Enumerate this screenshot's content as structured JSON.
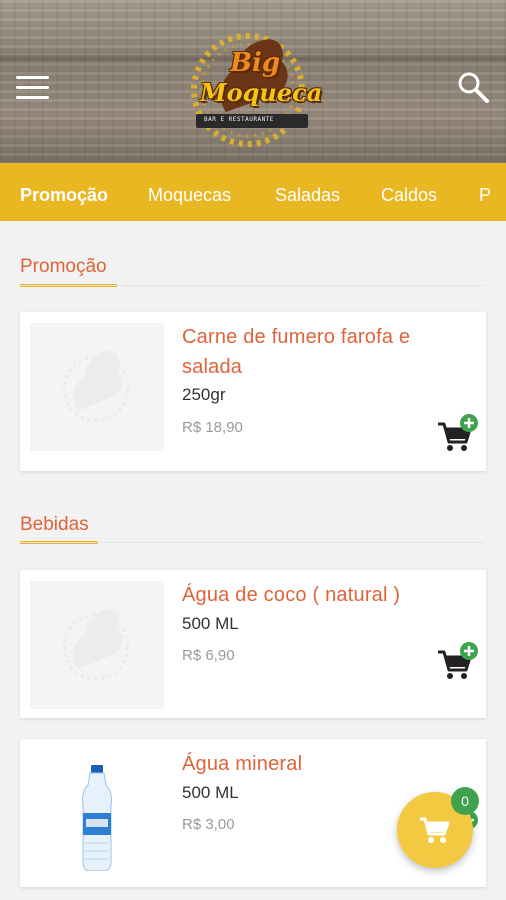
{
  "header": {
    "logo_line1": "Big",
    "logo_line2": "Moqueca",
    "logo_subtitle": "BAR E RESTAURANTE"
  },
  "tabs": [
    {
      "label": "Promoção",
      "active": true
    },
    {
      "label": "Moquecas",
      "active": false
    },
    {
      "label": "Saladas",
      "active": false
    },
    {
      "label": "Caldos",
      "active": false
    },
    {
      "label": "P",
      "active": false
    }
  ],
  "sections": [
    {
      "title": "Promoção",
      "products": [
        {
          "name": "Carne de fumero farofa e salada",
          "description": "250gr",
          "price": "R$ 18,90",
          "image": "logo-placeholder"
        }
      ]
    },
    {
      "title": "Bebidas",
      "products": [
        {
          "name": "Água de coco ( natural )",
          "description": "500 ML",
          "price": "R$ 6,90",
          "image": "logo-placeholder"
        },
        {
          "name": "Água mineral",
          "description": "500 ML",
          "price": "R$ 3,00",
          "image": "water-bottle"
        }
      ]
    }
  ],
  "cart": {
    "count": "0"
  },
  "colors": {
    "accent_yellow": "#e8b722",
    "title_orange": "#e0633a",
    "add_green": "#3fa34d",
    "fab_yellow": "#f3c941"
  }
}
